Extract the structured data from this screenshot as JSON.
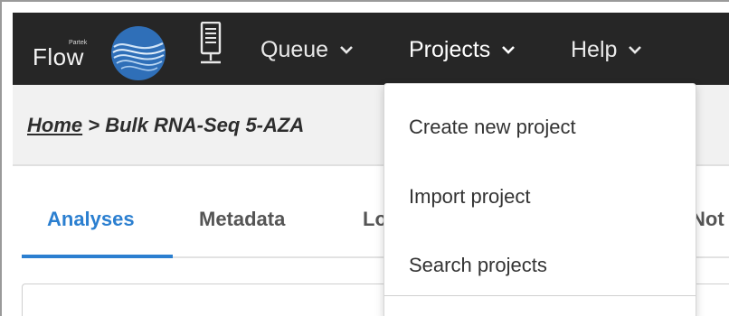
{
  "header": {
    "logo": {
      "brand_small": "Partek",
      "brand": "Flow"
    },
    "nav": [
      {
        "label": "Queue"
      },
      {
        "label": "Projects"
      },
      {
        "label": "Help"
      }
    ]
  },
  "breadcrumb": {
    "home": "Home",
    "separator": " > ",
    "current": "Bulk RNA-Seq 5-AZA"
  },
  "tabs": [
    {
      "label": "Analyses",
      "active": true
    },
    {
      "label": "Metadata"
    },
    {
      "label": "Lo"
    },
    {
      "label": "Not"
    }
  ],
  "projects_menu": {
    "items": [
      {
        "label": "Create new project"
      },
      {
        "label": "Import project"
      },
      {
        "label": "Search projects"
      }
    ]
  },
  "colors": {
    "navbar_bg": "#262626",
    "accent": "#2b7fd0",
    "globe": "#2f6fb8"
  }
}
